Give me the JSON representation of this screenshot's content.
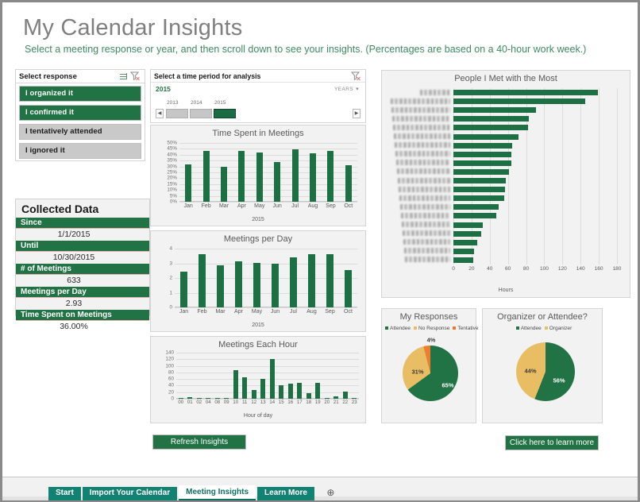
{
  "header": {
    "title": "My Calendar Insights",
    "subtitle": "Select a meeting response or year, and then scroll down to see your insights. (Percentages are based on a 40-hour work week.)"
  },
  "slicer": {
    "title": "Select response",
    "icons": {
      "multi_select": "multi-select-icon",
      "clear_filter": "clear-filter-icon"
    },
    "items": [
      {
        "label": "I organized it",
        "selected": true
      },
      {
        "label": "I confirmed it",
        "selected": true
      },
      {
        "label": "I tentatively attended",
        "selected": false
      },
      {
        "label": "I ignored it",
        "selected": false
      }
    ]
  },
  "timeline": {
    "title": "Select a time period for analysis",
    "selected_label": "2015",
    "level": "YEARS",
    "years": [
      "2013",
      "2014",
      "2015"
    ],
    "selected_year": "2015",
    "clear_icon": "clear-filter-icon",
    "prev_icon": "left-arrow-icon",
    "next_icon": "right-arrow-icon"
  },
  "collected_data": {
    "title": "Collected Data",
    "rows": [
      {
        "key": "Since",
        "value": "1/1/2015"
      },
      {
        "key": "Until",
        "value": "10/30/2015"
      },
      {
        "key": "# of Meetings",
        "value": "633"
      },
      {
        "key": "Meetings per Day",
        "value": "2.93"
      },
      {
        "key": "Time Spent on Meetings",
        "value": "36.00%"
      }
    ]
  },
  "buttons": {
    "refresh": "Refresh Insights",
    "learn_more": "Click here to learn more"
  },
  "tabs": {
    "items": [
      {
        "label": "Start",
        "active": false
      },
      {
        "label": "Import Your Calendar",
        "active": false
      },
      {
        "label": "Meeting Insights",
        "active": true
      },
      {
        "label": "Learn More",
        "active": false
      }
    ],
    "add_label": "⊕"
  },
  "colors": {
    "excel_green": "#217346",
    "bar_green": "#1d7044",
    "pie_amber": "#e9bd63",
    "pie_orange": "#ed7d31",
    "tab_teal": "#128272",
    "subtitle_green": "#3d8b62"
  },
  "chart_data": [
    {
      "id": "time_spent_in_meetings",
      "type": "bar",
      "title": "Time Spent in Meetings",
      "xlabel": "2015",
      "ylabel": "",
      "categories": [
        "Jan",
        "Feb",
        "Mar",
        "Apr",
        "May",
        "Jun",
        "Jul",
        "Aug",
        "Sep",
        "Oct"
      ],
      "values": [
        32,
        43,
        30,
        43.5,
        42,
        34,
        44.5,
        41,
        43.5,
        31
      ],
      "ylim": [
        0,
        50
      ],
      "yticks": [
        0,
        5,
        10,
        15,
        20,
        25,
        30,
        35,
        40,
        45,
        50
      ],
      "ytick_labels": [
        "0%",
        "5%",
        "10%",
        "15%",
        "20%",
        "25%",
        "30%",
        "35%",
        "40%",
        "45%",
        "50%"
      ],
      "grid": true,
      "legend": "none",
      "series_color": "#1d7044"
    },
    {
      "id": "meetings_per_day",
      "type": "bar",
      "title": "Meetings per Day",
      "xlabel": "2015",
      "ylabel": "",
      "categories": [
        "Jan",
        "Feb",
        "Mar",
        "Apr",
        "May",
        "Jun",
        "Jul",
        "Aug",
        "Sep",
        "Oct"
      ],
      "values": [
        2.42,
        3.6,
        2.88,
        3.12,
        3.05,
        3.0,
        3.4,
        3.6,
        3.6,
        2.55
      ],
      "ylim": [
        0,
        4
      ],
      "yticks": [
        0,
        1,
        2,
        3,
        4
      ],
      "ytick_labels": [
        "0",
        "1",
        "2",
        "3",
        "4"
      ],
      "grid": true,
      "legend": "none",
      "series_color": "#1d7044"
    },
    {
      "id": "meetings_each_hour",
      "type": "bar",
      "title": "Meetings Each Hour",
      "xlabel": "Hour of day",
      "ylabel": "",
      "categories": [
        "00",
        "01",
        "02",
        "04",
        "08",
        "09",
        "10",
        "11",
        "12",
        "13",
        "14",
        "15",
        "16",
        "17",
        "18",
        "19",
        "20",
        "21",
        "22",
        "23"
      ],
      "values": [
        1,
        4,
        1,
        1,
        1,
        1,
        88,
        66,
        27,
        60,
        121,
        42,
        46,
        48,
        16,
        48,
        1,
        8,
        22,
        3
      ],
      "ylim": [
        0,
        140
      ],
      "yticks": [
        0,
        20,
        40,
        60,
        80,
        100,
        120,
        140
      ],
      "ytick_labels": [
        "0",
        "20",
        "40",
        "60",
        "80",
        "100",
        "120",
        "140"
      ],
      "grid": true,
      "legend": "none",
      "series_color": "#1d7044"
    },
    {
      "id": "people_i_met_with_the_most",
      "type": "bar",
      "orientation": "horizontal",
      "title": "People I Met with the Most",
      "xlabel": "Hours",
      "ylabel": "",
      "categories": [
        "(name redacted)",
        "(name redacted)",
        "(name redacted)",
        "(name redacted)",
        "(name redacted)",
        "(name redacted)",
        "(name redacted)",
        "(name redacted)",
        "(name redacted)",
        "(name redacted)",
        "(name redacted)",
        "(name redacted)",
        "(name redacted)",
        "(name redacted)",
        "(name redacted)",
        "(name redacted)",
        "(name redacted)",
        "(name redacted)",
        "(name redacted)",
        "(name redacted)"
      ],
      "categories_blurred": true,
      "values": [
        159,
        145,
        91,
        83,
        82,
        72,
        65,
        64,
        64,
        61,
        58,
        57,
        56,
        50,
        47,
        32,
        31,
        26,
        23,
        22
      ],
      "xlim": [
        0,
        180
      ],
      "xticks": [
        0,
        20,
        40,
        60,
        80,
        100,
        120,
        140,
        160,
        180
      ],
      "xtick_labels": [
        "0",
        "20",
        "40",
        "60",
        "80",
        "100",
        "120",
        "140",
        "160",
        "180"
      ],
      "grid": true,
      "legend": "none",
      "series_color": "#1d7044"
    },
    {
      "id": "my_responses",
      "type": "pie",
      "title": "My Responses",
      "legend_position": "top",
      "labels": [
        "Attendee",
        "No Response",
        "Tentative"
      ],
      "values": [
        65,
        31,
        4
      ],
      "value_labels": [
        "65%",
        "31%",
        "4%"
      ],
      "colors": [
        "#217346",
        "#e9bd63",
        "#ed7d31"
      ]
    },
    {
      "id": "organizer_or_attendee",
      "type": "pie",
      "title": "Organizer or Attendee?",
      "legend_position": "top",
      "labels": [
        "Attendee",
        "Organizer"
      ],
      "values": [
        56,
        44
      ],
      "value_labels": [
        "56%",
        "44%"
      ],
      "colors": [
        "#217346",
        "#e9bd63"
      ]
    }
  ]
}
